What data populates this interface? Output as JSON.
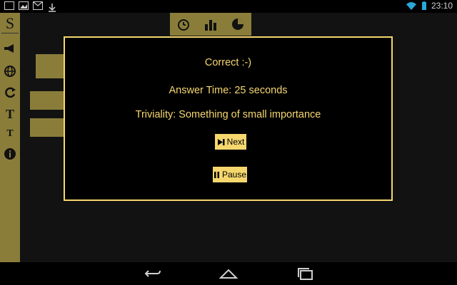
{
  "status": {
    "time": "23:10"
  },
  "app": {
    "logo": "S",
    "sidebar_icons": [
      "megaphone-icon",
      "globe-icon",
      "refresh-icon",
      "text-larger-icon",
      "text-smaller-icon",
      "info-icon"
    ],
    "topbar_icons": [
      "alarm-clock-icon",
      "bar-chart-icon",
      "pie-chart-icon"
    ]
  },
  "dialog": {
    "result": "Correct :-)",
    "answer_time": "Answer Time: 25 seconds",
    "triviality": "Triviality: Something of small importance",
    "next_label": "Next",
    "pause_label": "Pause"
  },
  "colors": {
    "accent": "#f5d76e",
    "background": "#000000",
    "dim_panel": "#8a7d3a"
  }
}
